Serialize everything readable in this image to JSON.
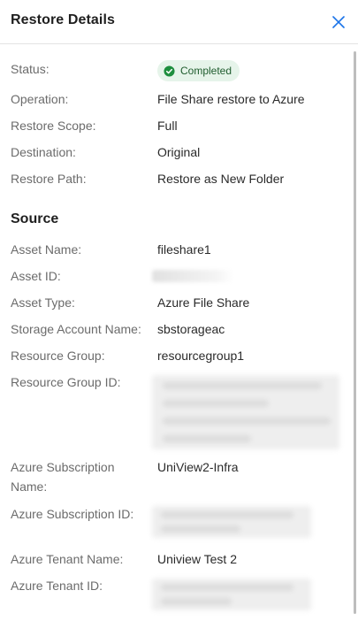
{
  "header": {
    "title": "Restore Details"
  },
  "status": {
    "label": "Status:",
    "value": "Completed",
    "color": "#1e8e3e",
    "bg": "#e6f4ea"
  },
  "details": {
    "operation_label": "Operation:",
    "operation_value": "File Share restore to Azure",
    "scope_label": "Restore Scope:",
    "scope_value": "Full",
    "destination_label": "Destination:",
    "destination_value": "Original",
    "path_label": "Restore Path:",
    "path_value": "Restore as New Folder"
  },
  "source": {
    "title": "Source",
    "asset_name_label": "Asset Name:",
    "asset_name_value": "fileshare1",
    "asset_id_label": "Asset ID:",
    "asset_type_label": "Asset Type:",
    "asset_type_value": "Azure File Share",
    "storage_label": "Storage Account Name:",
    "storage_value": "sbstorageac",
    "rg_label": "Resource Group:",
    "rg_value": "resourcegroup1",
    "rg_id_label": "Resource Group ID:",
    "sub_name_label_1": "Azure Subscription",
    "sub_name_label_2": "Name:",
    "sub_name_value": "UniView2-Infra",
    "sub_id_label": "Azure Subscription ID:",
    "tenant_name_label": "Azure Tenant Name:",
    "tenant_name_value": "Uniview Test 2",
    "tenant_id_label": "Azure Tenant ID:"
  },
  "icons": {
    "close": "close-icon",
    "status": "check-circle-icon"
  },
  "colors": {
    "accent": "#1a73e8"
  }
}
